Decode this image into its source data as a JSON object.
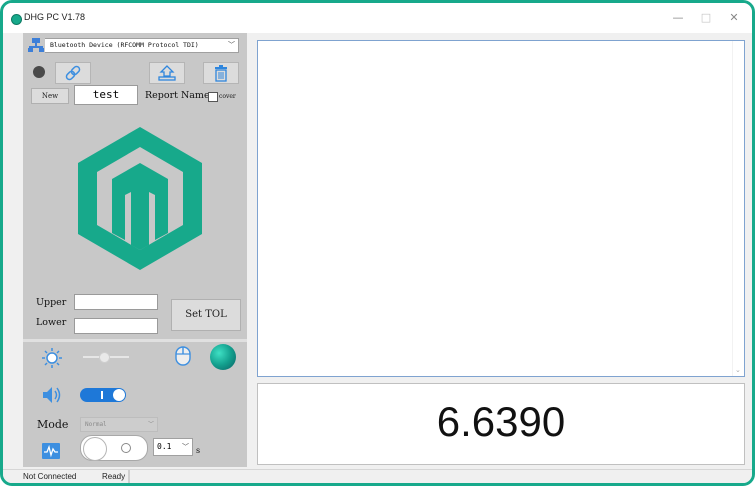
{
  "window": {
    "title": "DHG PC V1.78",
    "minimize": "—",
    "maximize": "□",
    "close": "✕"
  },
  "device": {
    "selected": "Bluetooth Device (RFCOMM Protocol TDI)"
  },
  "report": {
    "new_label": "New",
    "name_value": "test",
    "name_label": "Report Name",
    "cover_label": "cover"
  },
  "tolerance": {
    "upper_label": "Upper",
    "lower_label": "Lower",
    "set_label": "Set TOL"
  },
  "settings": {
    "mode_label": "Mode",
    "mode_value": "Normal",
    "interval_value": "0.1",
    "interval_unit": "s"
  },
  "reading": {
    "value": "6.6390"
  },
  "status": {
    "connection": "Not Connected",
    "state": "Ready"
  },
  "colors": {
    "accent": "#17a98b",
    "toggle_blue": "#1e78d8"
  }
}
